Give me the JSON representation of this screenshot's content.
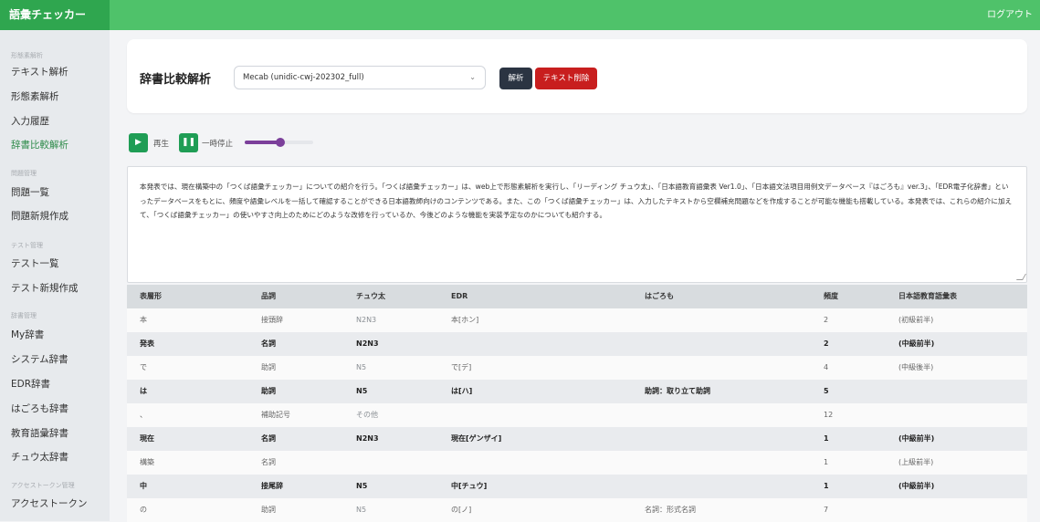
{
  "app": {
    "brand": "語彙チェッカー",
    "logout": "ログアウト"
  },
  "sidebar": {
    "sections": [
      {
        "label": "形態素解析",
        "items": [
          {
            "label": "テキスト解析"
          },
          {
            "label": "形態素解析"
          },
          {
            "label": "入力履歴"
          },
          {
            "label": "辞書比較解析",
            "active": true
          }
        ]
      },
      {
        "label": "問題管理",
        "items": [
          {
            "label": "問題一覧"
          },
          {
            "label": "問題新規作成"
          }
        ]
      },
      {
        "label": "テスト管理",
        "items": [
          {
            "label": "テスト一覧"
          },
          {
            "label": "テスト新規作成"
          }
        ]
      },
      {
        "label": "辞書管理",
        "items": [
          {
            "label": "My辞書"
          },
          {
            "label": "システム辞書"
          },
          {
            "label": "EDR辞書"
          },
          {
            "label": "はごろも辞書"
          },
          {
            "label": "教育語彙辞書"
          },
          {
            "label": "チュウ太辞書"
          }
        ]
      },
      {
        "label": "アクセストークン管理",
        "items": [
          {
            "label": "アクセストークン"
          }
        ]
      }
    ]
  },
  "main": {
    "title": "辞書比較解析",
    "dictionary_select": "Mecab (unidic-cwj-202302_full)",
    "analyze_button": "解析",
    "delete_button": "テキスト削除",
    "play_label": "再生",
    "pause_label": "一時停止",
    "speed_level": 0.52,
    "input_text": "本発表では、現在構築中の「つくば語彙チェッカー」についての紹介を行う。「つくば語彙チェッカー」は、web上で形態素解析を実行し、「リーディング チュウ太」、「日本語教育語彙表 Ver1.0」、「日本語文法項目用例文データベース『はごろも』ver.3」、「EDR電子化辞書」といったデータベースをもとに、頻度や語彙レベルを一括して確認することができる日本語教師向けのコンテンツである。また、この「つくば語彙チェッカー」は、入力したテキストから空欄補充問題などを作成することが可能な機能も搭載している。本発表では、これらの紹介に加えて、「つくば語彙チェッカー」の使いやすさ向上のためにどのような改修を行っているか、今後どのような機能を実装予定なのかについても紹介する。",
    "table": {
      "columns": [
        "表層形",
        "品詞",
        "チュウ太",
        "EDR",
        "はごろも",
        "頻度",
        "日本語教育語彙表"
      ],
      "rows": [
        [
          "本",
          "接頭辞",
          "N2N3",
          "本[ホン]",
          "",
          "2",
          "(初級前半)"
        ],
        [
          "発表",
          "名詞",
          "N2N3",
          "",
          "",
          "2",
          "(中級前半)"
        ],
        [
          "で",
          "助詞",
          "N5",
          "で[デ]",
          "",
          "4",
          "(中級後半)"
        ],
        [
          "は",
          "助詞",
          "N5",
          "は[ハ]",
          "助詞：取り立て助詞",
          "5",
          ""
        ],
        [
          "、",
          "補助記号",
          "その他",
          "",
          "",
          "12",
          ""
        ],
        [
          "現在",
          "名詞",
          "N2N3",
          "現在[ゲンザイ]",
          "",
          "1",
          "(中級前半)"
        ],
        [
          "構築",
          "名詞",
          "",
          "",
          "",
          "1",
          "(上級前半)"
        ],
        [
          "中",
          "接尾辞",
          "N5",
          "中[チュウ]",
          "",
          "1",
          "(中級前半)"
        ],
        [
          "の",
          "助詞",
          "N5",
          "の[ノ]",
          "名詞：形式名詞",
          "7",
          ""
        ]
      ]
    }
  }
}
